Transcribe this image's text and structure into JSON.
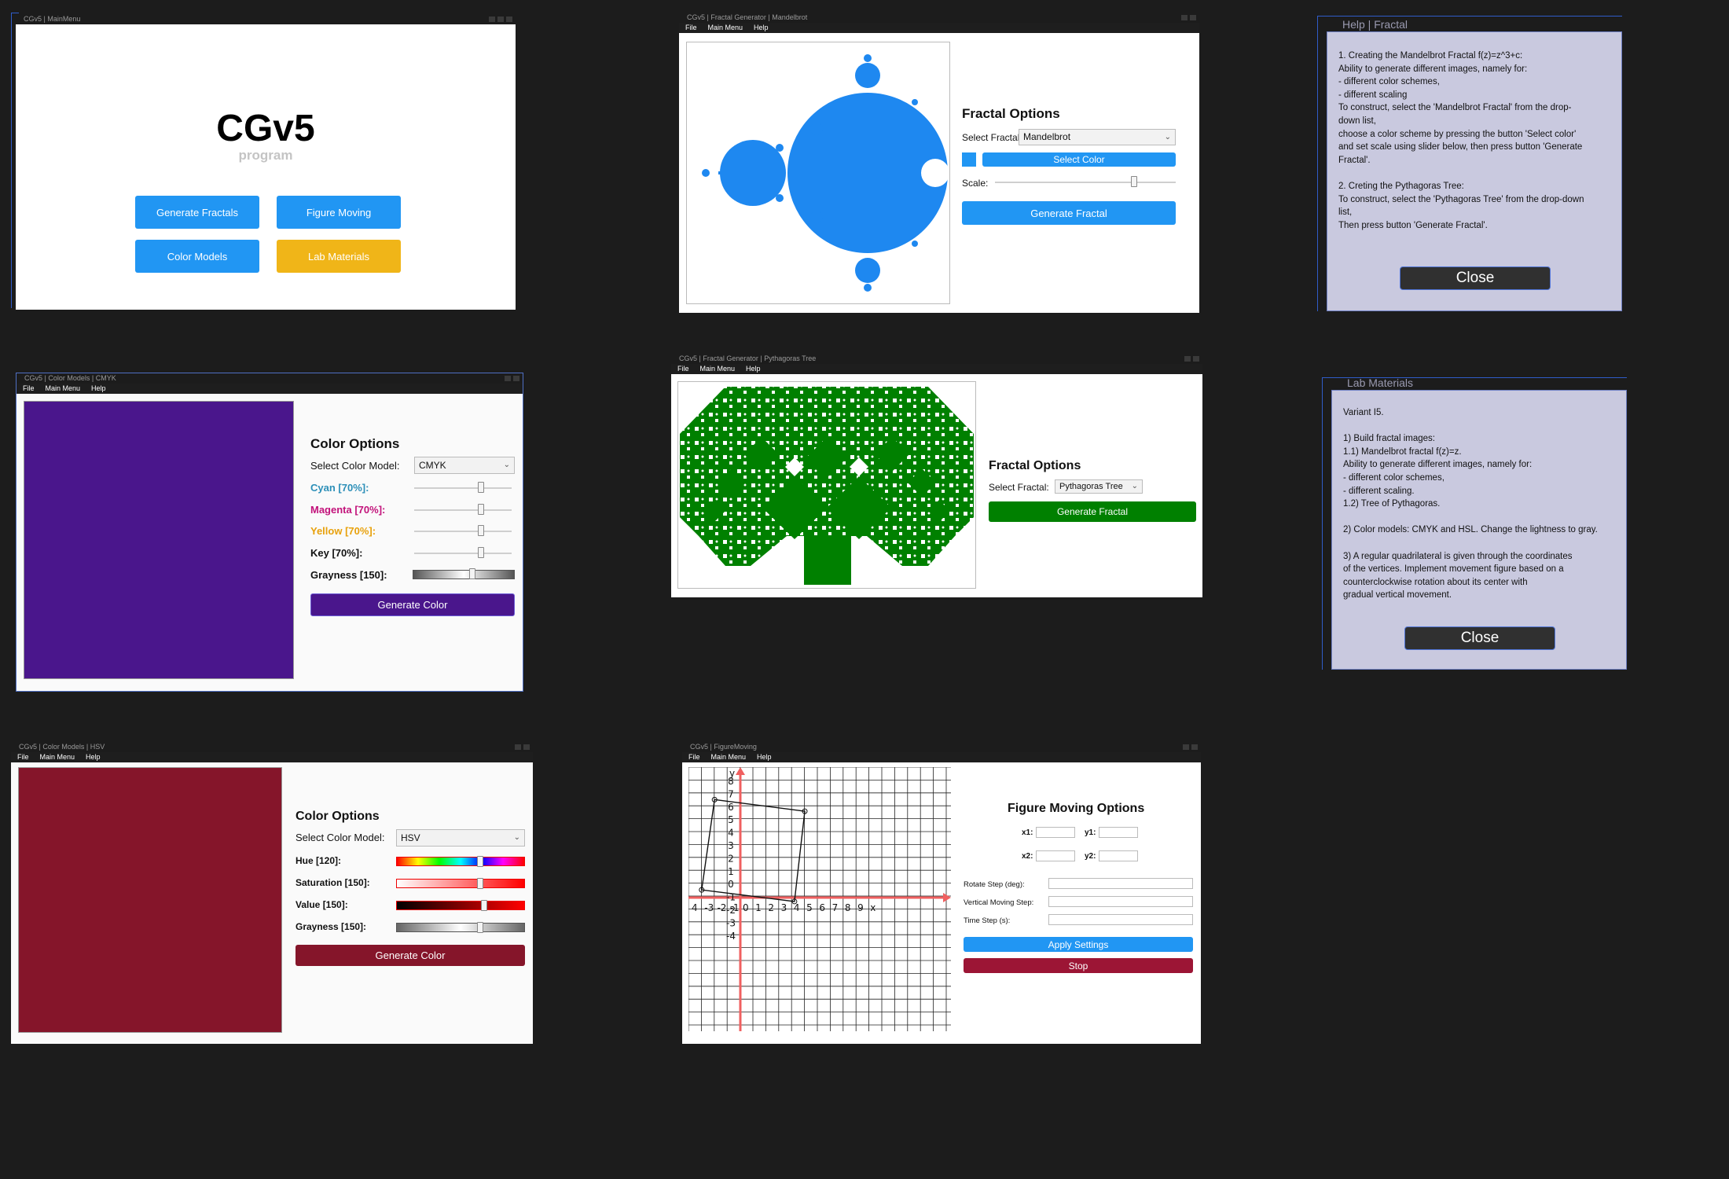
{
  "main_menu": {
    "title": "CGv5 | MainMenu",
    "app_name": "CGv5",
    "subtitle": "program",
    "buttons": [
      "Generate Fractals",
      "Figure Moving",
      "Color Models",
      "Lab Materials"
    ],
    "colors": {
      "primary": "#2196f3",
      "lab": "#f0b518"
    }
  },
  "menubar": [
    "File",
    "Main Menu",
    "Help"
  ],
  "mandelbrot": {
    "title": "CGv5 | Fractal Generator | Mandelbrot",
    "options_title": "Fractal Options",
    "select_label": "Select Fractal:",
    "selected": "Mandelbrot",
    "select_color": "Select Color",
    "scale_label": "Scale:",
    "scale_value": 0.78,
    "generate": "Generate Fractal",
    "fractal_color": "#1e88f0"
  },
  "help_fractal": {
    "title": "Help | Fractal",
    "text": "1. Creating the Mandelbrot Fractal f(z)=z^3+c:\nAbility to generate different images, namely for:\n- different color schemes,\n- different scaling\nTo construct, select the 'Mandelbrot Fractal' from the drop-\ndown list,\nchoose a color scheme by pressing the button 'Select color'\nand set scale using slider below, then press button 'Generate\nFractal'.\n\n2. Creting the Pythagoras Tree:\nTo construct, select the 'Pythagoras Tree' from the drop-down\nlist,\nThen press button 'Generate Fractal'.",
    "close": "Close"
  },
  "cmyk": {
    "title": "CGv5 | Color Models | CMYK",
    "options_title": "Color Options",
    "model_label": "Select Color Model:",
    "model": "CMYK",
    "sliders": [
      {
        "label": "Cyan [70%]:",
        "value": 0.7,
        "color": "#2c8fb8"
      },
      {
        "label": "Magenta [70%]:",
        "value": 0.7,
        "color": "#c2127a"
      },
      {
        "label": "Yellow [70%]:",
        "value": 0.7,
        "color": "#e8a10c"
      },
      {
        "label": "Key [70%]:",
        "value": 0.7,
        "color": "#111111"
      },
      {
        "label": "Grayness [150]:",
        "value": 0.59,
        "color": "#111111"
      }
    ],
    "generate": "Generate Color",
    "swatch": "#4a168c"
  },
  "pythagoras": {
    "title": "CGv5 | Fractal Generator | Pythagoras Tree",
    "options_title": "Fractal Options",
    "select_label": "Select Fractal:",
    "selected": "Pythagoras Tree",
    "generate": "Generate Fractal",
    "tree_color": "#008000"
  },
  "lab": {
    "title": "Lab Materials",
    "text": "Variant I5.\n\n1) Build fractal images:\n1.1) Mandelbrot fractal f(z)=z.\nAbility to generate different images, namely for:\n- different color schemes,\n- different scaling.\n1.2) Tree of Pythagoras.\n\n2) Color models: CMYK and HSL. Change the lightness to gray.\n\n3) A regular quadrilateral is given through the coordinates\nof the vertices. Implement movement figure based on a\ncounterclockwise rotation about its center with\ngradual vertical movement.",
    "close": "Close"
  },
  "hsv": {
    "title": "CGv5 | Color Models | HSV",
    "options_title": "Color Options",
    "model_label": "Select Color Model:",
    "model": "HSV",
    "sliders": [
      {
        "label": "Hue [120]:",
        "value": 0.66
      },
      {
        "label": "Saturation [150]:",
        "value": 0.66
      },
      {
        "label": "Value [150]:",
        "value": 0.69
      },
      {
        "label": "Grayness [150]:",
        "value": 0.66
      }
    ],
    "generate": "Generate Color",
    "swatch": "#85152a"
  },
  "figure_moving": {
    "title": "CGv5 | FigureMoving",
    "options_title": "Figure Moving Options",
    "x1": "x1:",
    "y1": "y1:",
    "x2": "x2:",
    "y2": "y2:",
    "rotate_label": "Rotate Step (deg):",
    "vertical_label": "Vertical Moving Step:",
    "time_label": "Time Step (s):",
    "apply": "Apply Settings",
    "stop": "Stop",
    "stop_color": "#9c1535",
    "x_ticks": [
      "4",
      "-3",
      "-2",
      "-1",
      "0",
      "1",
      "2",
      "3",
      "4",
      "5",
      "6",
      "7",
      "8",
      "9",
      "x"
    ],
    "y_ticks": [
      "8",
      "7",
      "6",
      "5",
      "4",
      "3",
      "2",
      "1",
      "0",
      "-1",
      "-2",
      "-3",
      "-4"
    ],
    "y_axis_label": "y",
    "quad": [
      [
        -2,
        7.6
      ],
      [
        5,
        6.7
      ],
      [
        4.2,
        -0.3
      ],
      [
        -3,
        0.6
      ]
    ]
  }
}
